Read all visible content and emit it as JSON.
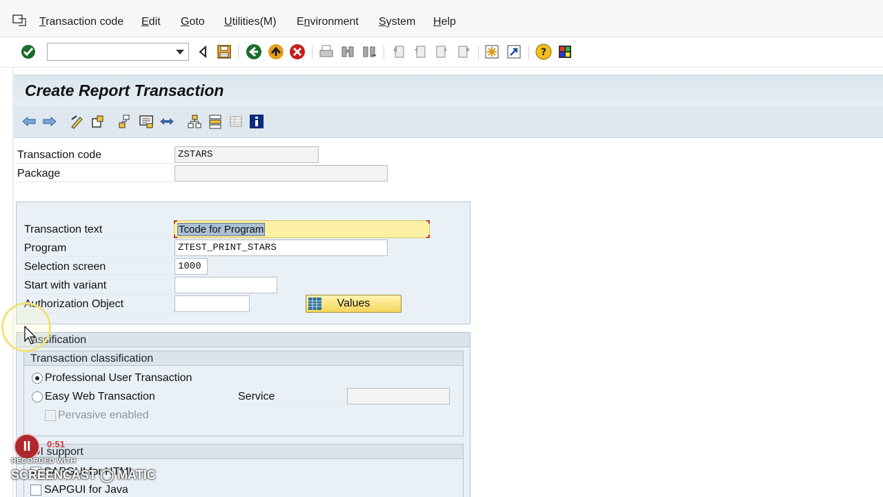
{
  "menu": {
    "items": [
      "Transaction code",
      "Edit",
      "Goto",
      "Utilities(M)",
      "Environment",
      "System",
      "Help"
    ],
    "underline_chars": [
      "T",
      "E",
      "G",
      "U",
      "n",
      "S",
      "H"
    ]
  },
  "toolbar": {
    "command_field_value": "",
    "icons": [
      "enter-icon",
      "back-triangle-icon",
      "save-icon",
      "back-icon",
      "exit-icon",
      "cancel-icon",
      "print-icon",
      "find-icon",
      "find-next-icon",
      "first-page-icon",
      "previous-page-icon",
      "next-page-icon",
      "last-page-icon",
      "create-session-icon",
      "shortcut-icon",
      "help-icon",
      "customize-layout-icon"
    ]
  },
  "title": "Create Report Transaction",
  "app_toolbar": {
    "icons": [
      "back-arrow-icon",
      "forward-arrow-icon",
      "display-change-icon",
      "other-object-icon",
      "where-used-icon",
      "display-object-list-icon",
      "navigation-icon",
      "hierarchy-icon",
      "structure-icon",
      "table-icon",
      "info-icon"
    ]
  },
  "form": {
    "transaction_code": {
      "label": "Transaction code",
      "value": "ZSTARS"
    },
    "package": {
      "label": "Package",
      "value": ""
    },
    "transaction_text": {
      "label": "Transaction text",
      "value": "Tcode for Program"
    },
    "program": {
      "label": "Program",
      "value": "ZTEST_PRINT_STARS"
    },
    "selection_screen": {
      "label": "Selection screen",
      "value": "1000"
    },
    "start_with_variant": {
      "label": "Start with variant",
      "value": ""
    },
    "authorization_object": {
      "label": "Authorization Object",
      "value": ""
    },
    "values_button": "Values"
  },
  "classification": {
    "title": "assification",
    "transaction_classification": {
      "title": "Transaction classification",
      "options": [
        {
          "label": "Professional User Transaction",
          "selected": true
        },
        {
          "label": "Easy Web Transaction",
          "selected": false
        }
      ],
      "service_label": "Service",
      "service_value": "",
      "pervasive_label": "Pervasive enabled"
    },
    "gui_support": {
      "title": "UI support",
      "options": [
        {
          "label": "SAPGUI for HTML",
          "checked": true
        },
        {
          "label": "SAPGUI for Java",
          "checked": false
        }
      ]
    }
  },
  "watermark": {
    "time": "0:51",
    "recorded": "RECORDED WITH",
    "brand": "SCREENCAST ◯ MATIC"
  }
}
